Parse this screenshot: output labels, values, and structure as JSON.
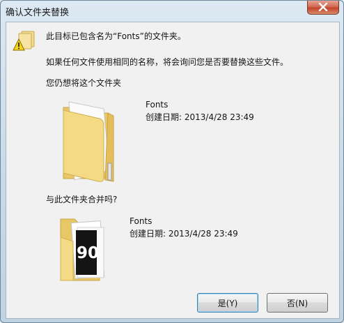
{
  "window": {
    "title": "确认文件夹替换"
  },
  "message": {
    "line1": "此目标已包含名为“Fonts”的文件夹。",
    "line2": "如果任何文件使用相同的名称，将会询问您是否要替换这些文件。",
    "line3": "您仍想将这个文件夹"
  },
  "source_folder": {
    "name": "Fonts",
    "created": "创建日期: 2013/4/28 23:49"
  },
  "merge_prompt": "与此文件夹合并吗?",
  "target_folder": {
    "name": "Fonts",
    "created": "创建日期: 2013/4/28 23:49",
    "thumbnail_text": "90"
  },
  "buttons": {
    "yes": "是(Y)",
    "no": "否(N)"
  },
  "icons": {
    "warning": "warning-folder-icon",
    "close": "close-icon",
    "folder": "folder-icon"
  },
  "colors": {
    "folder_yellow": "#f2d77e",
    "title_bar": "#cfe0ee",
    "close_button": "#c9503a"
  }
}
